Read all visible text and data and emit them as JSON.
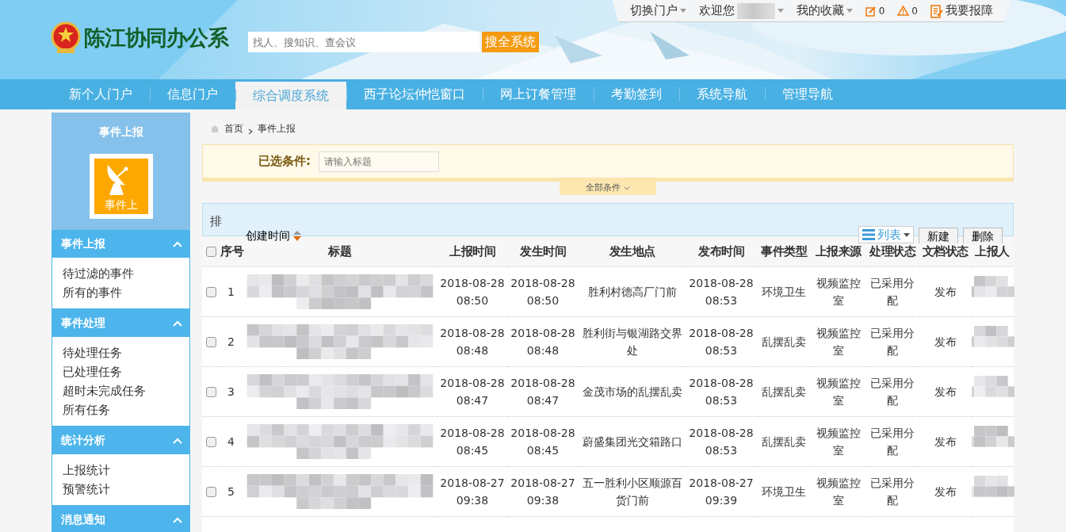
{
  "header": {
    "site_title": "陈江协同办公系",
    "search": {
      "placeholder": "找人、搜知识、查会议",
      "button": "搜全系统"
    },
    "top_bar": [
      {
        "kind": "menu",
        "label": "切换门户"
      },
      {
        "kind": "user",
        "label": "欢迎您"
      },
      {
        "kind": "menu",
        "label": "我的收藏"
      },
      {
        "kind": "edit",
        "label": "0"
      },
      {
        "kind": "warning",
        "label": "0"
      },
      {
        "kind": "report",
        "label": "我要报障"
      }
    ]
  },
  "nav_tabs": [
    {
      "label": "新个人门户",
      "selected": false
    },
    {
      "label": "信息门户",
      "selected": false
    },
    {
      "label": "综合调度系统",
      "selected": true
    },
    {
      "label": "西子论坛仲恺窗口",
      "selected": false
    },
    {
      "label": "网上订餐管理",
      "selected": false
    },
    {
      "label": "考勤签到",
      "selected": false
    },
    {
      "label": "系统导航",
      "selected": false
    },
    {
      "label": "管理导航",
      "selected": false
    }
  ],
  "sidebar": {
    "title": "事件上报",
    "tile_label": "事件上",
    "sections": [
      {
        "title": "事件上报",
        "expanded": true,
        "items": [
          "待过滤的事件",
          "所有的事件"
        ]
      },
      {
        "title": "事件处理",
        "expanded": true,
        "items": [
          "待处理任务",
          "已处理任务",
          "超时未完成任务",
          "所有任务"
        ]
      },
      {
        "title": "统计分析",
        "expanded": true,
        "items": [
          "上报统计",
          "预警统计"
        ]
      },
      {
        "title": "消息通知",
        "expanded": true
      }
    ]
  },
  "breadcrumb": [
    "首页",
    "事件上报"
  ],
  "filter": {
    "label": "已选条件:",
    "placeholder": "请输入标题",
    "toggle": "全部条件"
  },
  "sort_bar": {
    "label": "排",
    "sort_field": "创建时间"
  },
  "toolbar": {
    "view": "列表",
    "buttons": [
      "新建",
      "删除"
    ]
  },
  "table": {
    "header_checked": false,
    "columns": [
      "序号",
      "标题",
      "上报时间",
      "发生时间",
      "发生地点",
      "发布时间",
      "事件类型",
      "上报来源",
      "处理状态",
      "文档状态",
      "上报人"
    ],
    "rows": [
      {
        "checked": false,
        "index": "1",
        "reported": "2018-08-28 08:50",
        "occurred": "2018-08-28 08:50",
        "location": "胜利村德高厂门前",
        "published": "2018-08-28 08:53",
        "type": "环境卫生",
        "source": "视频监控室",
        "process_status": "已采用分配",
        "doc_status": "发布"
      },
      {
        "checked": false,
        "index": "2",
        "reported": "2018-08-28 08:48",
        "occurred": "2018-08-28 08:48",
        "location": "胜利街与银湖路交界处",
        "published": "2018-08-28 08:53",
        "type": "乱摆乱卖",
        "source": "视频监控室",
        "process_status": "已采用分配",
        "doc_status": "发布"
      },
      {
        "checked": false,
        "index": "3",
        "reported": "2018-08-28 08:47",
        "occurred": "2018-08-28 08:47",
        "location": "金茂市场的乱摆乱卖",
        "published": "2018-08-28 08:53",
        "type": "乱摆乱卖",
        "source": "视频监控室",
        "process_status": "已采用分配",
        "doc_status": "发布"
      },
      {
        "checked": false,
        "index": "4",
        "reported": "2018-08-28 08:45",
        "occurred": "2018-08-28 08:45",
        "location": "蔚盛集团光交箱路口",
        "published": "2018-08-28 08:53",
        "type": "乱摆乱卖",
        "source": "视频监控室",
        "process_status": "已采用分配",
        "doc_status": "发布"
      },
      {
        "checked": false,
        "index": "5",
        "reported": "2018-08-27 09:38",
        "occurred": "2018-08-27 09:38",
        "location": "五一胜利小区顺源百货门前",
        "published": "2018-08-27 09:39",
        "type": "环境卫生",
        "source": "视频监控室",
        "process_status": "已采用分配",
        "doc_status": "发布"
      }
    ]
  }
}
